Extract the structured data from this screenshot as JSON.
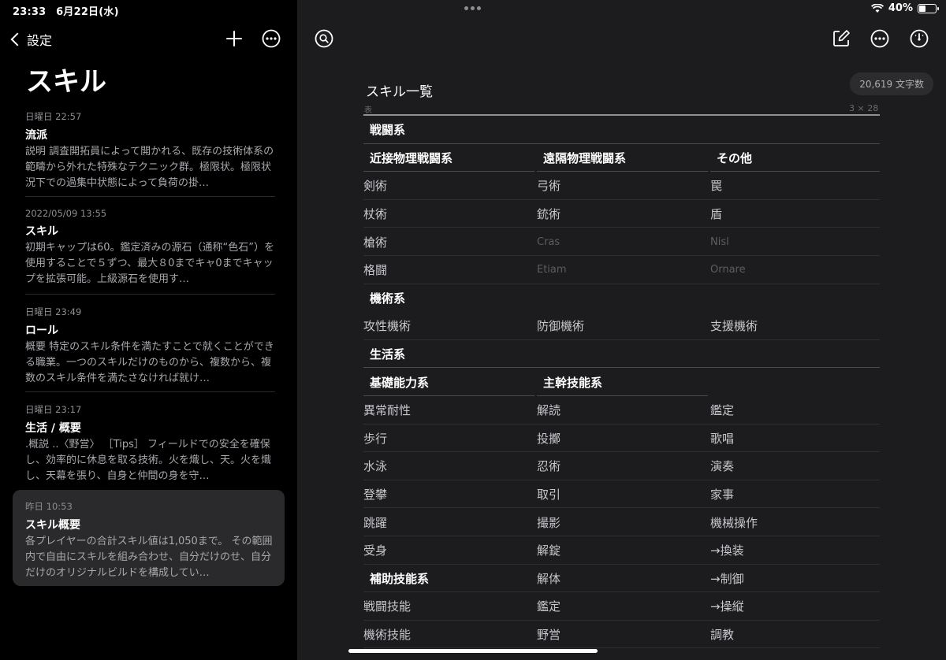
{
  "status": {
    "time": "23:33",
    "date": "6月22日(水)",
    "battery": "40%",
    "battery_level": 0.4
  },
  "sidebar": {
    "back_label": "設定",
    "folder_title": "スキル",
    "notes": [
      {
        "date": "日曜日 22:57",
        "title": "流派",
        "excerpt": "説明 調査開拓員によって開かれる、既存の技術体系の範疇から外れた特殊なテクニック群。極限状。極限状況下での過集中状態によって負荷の掛…"
      },
      {
        "date": "2022/05/09 13:55",
        "title": "スキル",
        "excerpt": "初期キャップは60。鑑定済みの源石（通称“色石”）を使用することで５ずつ、最大８0までキャ0までキャップを拡張可能。上級源石を使用す…"
      },
      {
        "date": "日曜日 23:49",
        "title": "ロール",
        "excerpt": "概要 特定のスキル条件を満たすことで就くことができる職業。一つのスキルだけのものから、複数から、複数のスキル条件を満たさなければ就け…"
      },
      {
        "date": "日曜日 23:17",
        "title": "生活 / 概要",
        "excerpt": ".概説 ..〈野営〉 ［Tips］ フィールドでの安全を確保し、効率的に休息を取る技術。火を熾し、天。火を熾し、天幕を張り、自身と仲間の身を守…"
      },
      {
        "date": "昨日 10:53",
        "title": "スキル概要",
        "excerpt": "各プレイヤーの合計スキル値は1,050まで。 その範囲内で自由にスキルを組み合わせ、自分だけのせ、自分だけのオリジナルビルドを構成してい…"
      }
    ]
  },
  "editor": {
    "word_count": "20,619 文字数",
    "doc_title": "スキル一覧",
    "table_caption": "表",
    "table_size": "3 × 28",
    "rows": [
      {
        "type": "cat",
        "cells": [
          "戦闘系"
        ]
      },
      {
        "type": "sub",
        "cells": [
          "近接物理戦闘系",
          "遠隔物理戦闘系",
          "その他"
        ]
      },
      {
        "type": "item",
        "cells": [
          "剣術",
          "弓術",
          "罠"
        ]
      },
      {
        "type": "item",
        "cells": [
          "杖術",
          "銃術",
          "盾"
        ]
      },
      {
        "type": "item",
        "cells": [
          "槍術",
          "Cras",
          "Nisl"
        ],
        "dim": [
          false,
          true,
          true
        ]
      },
      {
        "type": "item",
        "cells": [
          "格闘",
          "Etiam",
          "Ornare"
        ],
        "dim": [
          false,
          true,
          true
        ]
      },
      {
        "type": "cat",
        "cells": [
          "機術系"
        ],
        "noline": true
      },
      {
        "type": "item",
        "cells": [
          "攻性機術",
          "防御機術",
          "支援機術"
        ]
      },
      {
        "type": "cat",
        "cells": [
          "生活系"
        ]
      },
      {
        "type": "sub",
        "cells": [
          "基礎能力系",
          "主幹技能系",
          ""
        ]
      },
      {
        "type": "item",
        "cells": [
          "異常耐性",
          "解読",
          "鑑定"
        ]
      },
      {
        "type": "item",
        "cells": [
          "歩行",
          "投擲",
          "歌唱"
        ]
      },
      {
        "type": "item",
        "cells": [
          "水泳",
          "忍術",
          "演奏"
        ]
      },
      {
        "type": "item",
        "cells": [
          "登攀",
          "取引",
          "家事"
        ]
      },
      {
        "type": "item",
        "cells": [
          "跳躍",
          "撮影",
          "機械操作"
        ]
      },
      {
        "type": "item",
        "cells": [
          "受身",
          "解錠",
          "→換装"
        ]
      },
      {
        "type": "mixed",
        "cells": [
          "補助技能系",
          "解体",
          "→制御"
        ]
      },
      {
        "type": "item",
        "cells": [
          "戦闘技能",
          "鑑定",
          "→操縦"
        ]
      },
      {
        "type": "item",
        "cells": [
          "機術技能",
          "野営",
          "調教"
        ]
      }
    ]
  }
}
